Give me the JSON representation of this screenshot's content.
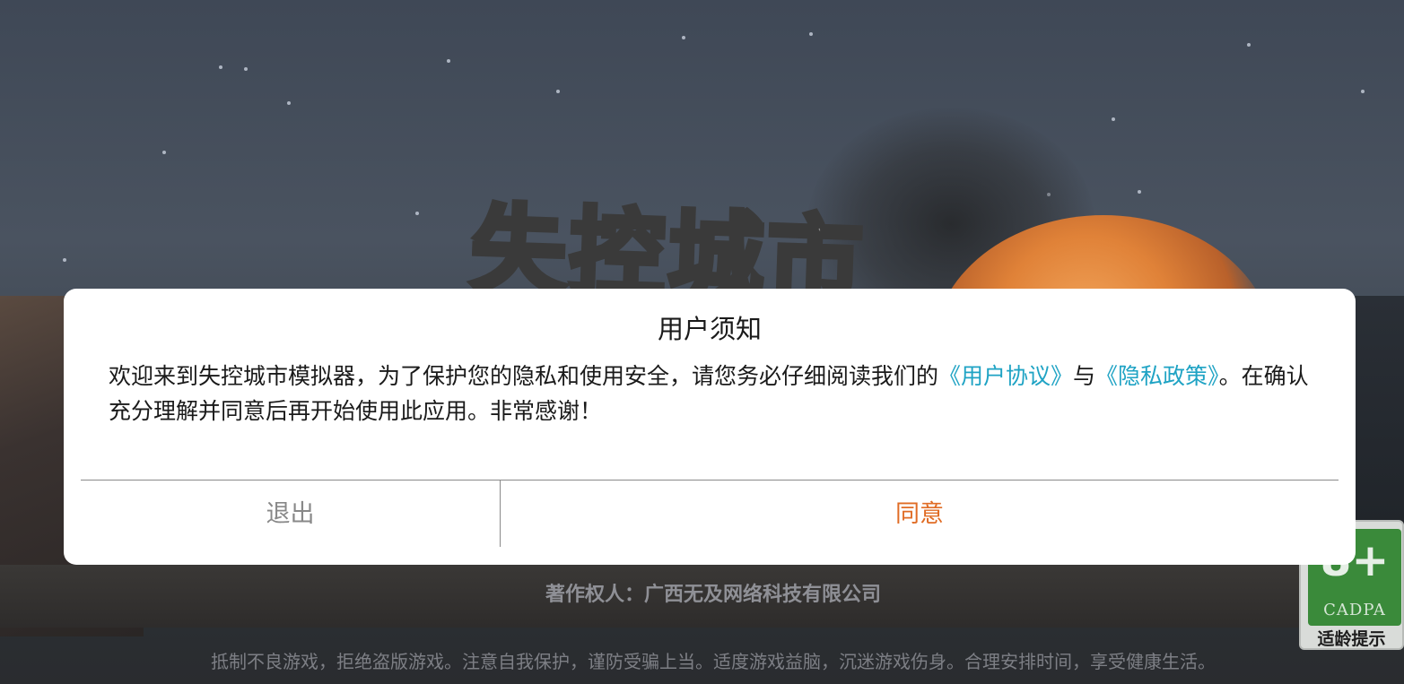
{
  "background": {
    "game_title_art": "失控城市",
    "copyright": "著作权人：广西无及网络科技有限公司",
    "health_notice": "抵制不良游戏，拒绝盗版游戏。注意自我保护，谨防受骗上当。适度游戏益脑，沉迷游戏伤身。合理安排时间，享受健康生活。"
  },
  "age_rating": {
    "age": "8+",
    "org": "CADPA",
    "tip": "适龄提示"
  },
  "dialog": {
    "title": "用户须知",
    "body_part1": "欢迎来到失控城市模拟器，为了保护您的隐私和使用安全，请您务必仔细阅读我们的",
    "link_user_agreement": "《用户协议》",
    "conjunction": "与",
    "link_privacy_policy": "《隐私政策》",
    "body_part2": "。在确认充分理解并同意后再开始使用此应用。非常感谢！",
    "exit_label": "退出",
    "agree_label": "同意"
  },
  "colors": {
    "link": "#1fa3c4",
    "agree": "#e06c25",
    "exit": "#888888"
  }
}
